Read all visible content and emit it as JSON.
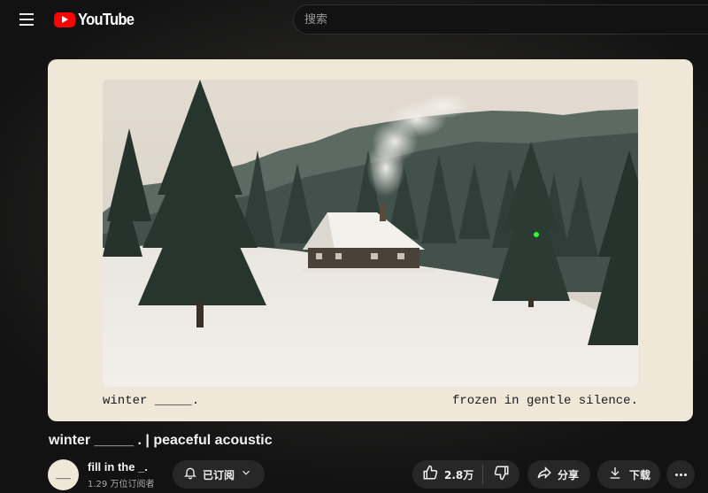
{
  "header": {
    "logo_text": "YouTube",
    "search_placeholder": "搜索"
  },
  "player": {
    "caption_left": "winter _____.",
    "caption_right": "frozen in gentle silence."
  },
  "video": {
    "title": "winter _____ . | peaceful acoustic"
  },
  "channel": {
    "avatar_text": "___",
    "name": "fill in the _.",
    "subscribers": "1.29 万位订阅者",
    "subscribed_label": "已订阅"
  },
  "actions": {
    "like_count": "2.8万",
    "share_label": "分享",
    "download_label": "下载"
  },
  "colors": {
    "brand_red": "#ff0000",
    "pill_bg": "#272727",
    "frame_bg": "#efe8d8"
  },
  "icons": [
    "menu-icon",
    "youtube-logo-icon",
    "bell-icon",
    "chevron-down-icon",
    "thumb-up-icon",
    "thumb-down-icon",
    "share-icon",
    "download-icon",
    "more-icon"
  ]
}
